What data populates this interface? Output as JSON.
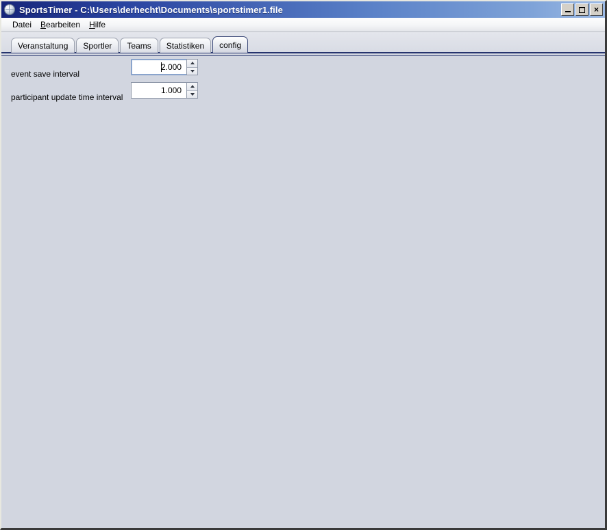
{
  "window": {
    "title": "SportsTimer - C:\\Users\\derhecht\\Documents\\sportstimer1.file",
    "icon": "globe-icon",
    "controls": {
      "minimize_label": "_",
      "maximize_label": "□",
      "close_label": "×"
    },
    "colors": {
      "titlebar_start": "#16257a",
      "titlebar_end": "#9dbbe6",
      "panel_background": "#d2d6e0",
      "tab_underline": "#26346e",
      "field_background": "#ffffff",
      "focus_border": "#8aa4cc"
    }
  },
  "menubar": {
    "items": [
      {
        "label": "Datei",
        "mnemonic": ""
      },
      {
        "label": "Bearbeiten",
        "mnemonic": "B"
      },
      {
        "label": "Hilfe",
        "mnemonic": "H"
      }
    ]
  },
  "tabs": {
    "selected": "config",
    "items": [
      {
        "label": "Veranstaltung"
      },
      {
        "label": "Sportler"
      },
      {
        "label": "Teams"
      },
      {
        "label": "Statistiken"
      },
      {
        "label": "config"
      }
    ]
  },
  "config_panel": {
    "fields": [
      {
        "label": "event save interval",
        "value": "2.000",
        "focused": true,
        "spinner_up": "increment-arrow",
        "spinner_down": "decrement-arrow"
      },
      {
        "label": "participant update time interval",
        "value": "1.000",
        "focused": false,
        "spinner_up": "increment-arrow",
        "spinner_down": "decrement-arrow"
      }
    ]
  }
}
